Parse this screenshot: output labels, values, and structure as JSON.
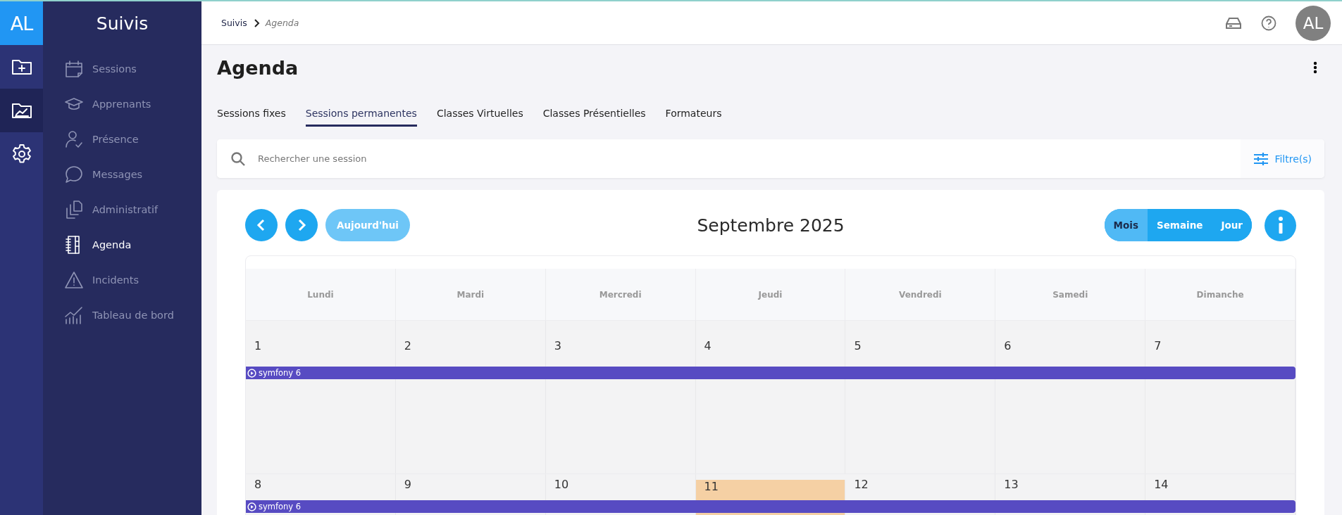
{
  "logo": {
    "text": "AL"
  },
  "rail": {
    "items": [
      {
        "kind": "folder-plus",
        "selected": false
      },
      {
        "kind": "folder-chart",
        "selected": true
      },
      {
        "kind": "gear",
        "selected": false
      }
    ]
  },
  "sidebar": {
    "title": "Suivis",
    "items": [
      {
        "label": "Sessions",
        "kind": "calendar",
        "selected": false
      },
      {
        "label": "Apprenants",
        "kind": "graduation-cap",
        "selected": false
      },
      {
        "label": "Présence",
        "kind": "person-check",
        "selected": false
      },
      {
        "label": "Messages",
        "kind": "speech-bubble",
        "selected": false
      },
      {
        "label": "Administratif",
        "kind": "documents",
        "selected": false
      },
      {
        "label": "Agenda",
        "kind": "notebook",
        "selected": true
      },
      {
        "label": "Incidents",
        "kind": "warning",
        "selected": false
      },
      {
        "label": "Tableau de bord",
        "kind": "bar-chart",
        "selected": false
      }
    ]
  },
  "breadcrumb": {
    "parent": "Suivis",
    "current": "Agenda"
  },
  "avatar": {
    "initials": "AL"
  },
  "page_title": "Agenda",
  "tabs": [
    {
      "label": "Sessions fixes",
      "selected": false
    },
    {
      "label": "Sessions permanentes",
      "selected": true
    },
    {
      "label": "Classes Virtuelles",
      "selected": false
    },
    {
      "label": "Classes Présentielles",
      "selected": false
    },
    {
      "label": "Formateurs",
      "selected": false
    }
  ],
  "search": {
    "placeholder": "Rechercher une session",
    "filter_label": "Filtre(s)"
  },
  "calendar": {
    "today_label": "Aujourd'hui",
    "month": "Septembre 2025",
    "views": [
      {
        "label": "Mois",
        "selected": true
      },
      {
        "label": "Semaine",
        "selected": false
      },
      {
        "label": "Jour",
        "selected": false
      }
    ],
    "weekdays": [
      "Lundi",
      "Mardi",
      "Mercredi",
      "Jeudi",
      "Vendredi",
      "Samedi",
      "Dimanche"
    ],
    "weeks": [
      {
        "days": [
          {
            "number": "1",
            "today": false
          },
          {
            "number": "2",
            "today": false
          },
          {
            "number": "3",
            "today": false
          },
          {
            "number": "4",
            "today": false
          },
          {
            "number": "5",
            "today": false
          },
          {
            "number": "6",
            "today": false
          },
          {
            "number": "7",
            "today": false
          }
        ],
        "events": [
          {
            "label": "symfony 6"
          }
        ]
      },
      {
        "days": [
          {
            "number": "8",
            "today": false
          },
          {
            "number": "9",
            "today": false
          },
          {
            "number": "10",
            "today": false
          },
          {
            "number": "11",
            "today": true
          },
          {
            "number": "12",
            "today": false
          },
          {
            "number": "13",
            "today": false
          },
          {
            "number": "14",
            "today": false
          }
        ],
        "events": [
          {
            "label": "symfony 6"
          }
        ]
      }
    ]
  }
}
